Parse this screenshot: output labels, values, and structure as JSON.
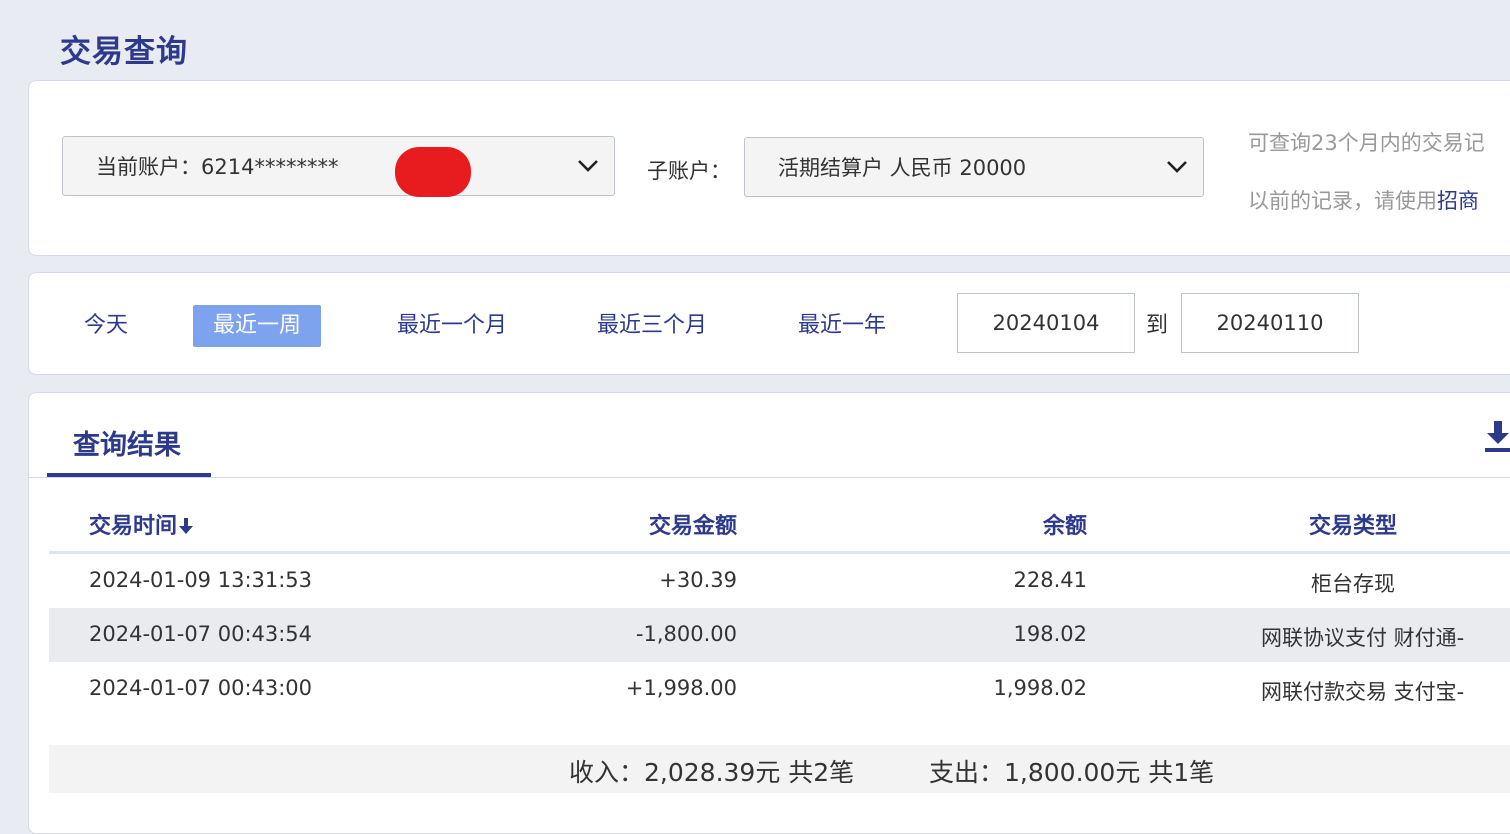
{
  "page_title": "交易查询",
  "account": {
    "current_label": "当前账户：6214********",
    "sub_label": "子账户：",
    "sub_value": "活期结算户 人民币 20000",
    "note_line1": "可查询23个月内的交易记",
    "note_line2_prefix": "以前的记录，请使用",
    "note_line2_link": "招商"
  },
  "date_range": {
    "buttons": [
      "今天",
      "最近一周",
      "最近一个月",
      "最近三个月",
      "最近一年"
    ],
    "active": "最近一周",
    "start": "20240104",
    "separator": "到",
    "end": "20240110"
  },
  "result": {
    "tab_label": "查询结果",
    "columns": [
      "交易时间",
      "交易金额",
      "余额",
      "交易类型"
    ],
    "rows": [
      {
        "time": "2024-01-09  13:31:53",
        "amount": "+30.39",
        "balance": "228.41",
        "type": "柜台存现"
      },
      {
        "time": "2024-01-07  00:43:54",
        "amount": "-1,800.00",
        "balance": "198.02",
        "type": "网联协议支付  财付通-"
      },
      {
        "time": "2024-01-07  00:43:00",
        "amount": "+1,998.00",
        "balance": "1,998.02",
        "type": "网联付款交易  支付宝-"
      }
    ],
    "summary_income": "收入：2,028.39元  共2笔",
    "summary_expense": "支出：1,800.00元  共1笔"
  }
}
